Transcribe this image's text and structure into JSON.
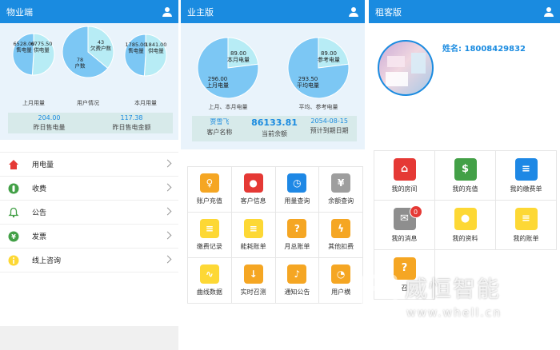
{
  "panel1": {
    "title": "物业端",
    "charts": [
      {
        "label_a_value": "6775.50",
        "label_a_name": "供电量",
        "label_b_value": "6528.00",
        "label_b_name": "售电量",
        "caption": "上月用量",
        "fractions": [
          0.51,
          0.49
        ]
      },
      {
        "label_a_value": "43",
        "label_a_name": "欠费户数",
        "label_b_value": "78",
        "label_b_name": "户数",
        "caption": "用户情况",
        "fractions": [
          0.36,
          0.64
        ]
      },
      {
        "label_a_value": "1841.00",
        "label_a_name": "供电量",
        "label_b_value": "1785.00",
        "label_b_name": "售电量",
        "caption": "本月用量",
        "fractions": [
          0.51,
          0.49
        ]
      }
    ],
    "summary": [
      {
        "value": "204.00",
        "label": "昨日售电量"
      },
      {
        "value": "117.38",
        "label": "昨日售电金额"
      }
    ],
    "menu": [
      {
        "label": "用电量",
        "icon": "home-icon",
        "color": "#e53935"
      },
      {
        "label": "收费",
        "icon": "money-icon",
        "color": "#43a047"
      },
      {
        "label": "公告",
        "icon": "bell-icon",
        "color": "#43a047"
      },
      {
        "label": "发票",
        "icon": "yen-icon",
        "color": "#43a047"
      },
      {
        "label": "线上咨询",
        "icon": "info-icon",
        "color": "#fdd835"
      }
    ]
  },
  "panel2": {
    "title": "业主版",
    "charts": [
      {
        "label_a_value": "89.00",
        "label_a_name": "本月电量",
        "label_b_value": "296.00",
        "label_b_name": "上月电量",
        "caption": "上月、本月电量",
        "fractions": [
          0.23,
          0.77
        ]
      },
      {
        "label_a_value": "89.00",
        "label_a_name": "参考电量",
        "label_b_value": "293.50",
        "label_b_name": "平均电量",
        "caption": "平均、参考电量",
        "fractions": [
          0.23,
          0.77
        ]
      }
    ],
    "info": {
      "name_value": "贾雪飞",
      "name_label": "客户名称",
      "balance_value": "86133.81",
      "balance_label": "当前余额",
      "date_value": "2054-08-15",
      "date_label": "预计到期日期"
    },
    "grid": [
      {
        "label": "账户充值",
        "color": "#f5a623",
        "glyph": "♀",
        "icon": "wallet-icon"
      },
      {
        "label": "客户信息",
        "color": "#e53935",
        "glyph": "●",
        "icon": "person-icon"
      },
      {
        "label": "用量查询",
        "color": "#1e88e5",
        "glyph": "◷",
        "icon": "clock-icon"
      },
      {
        "label": "余额查询",
        "color": "#9e9e9e",
        "glyph": "¥",
        "icon": "yen-icon"
      },
      {
        "label": "缴费记录",
        "color": "#fdd835",
        "glyph": "≡",
        "icon": "list-icon"
      },
      {
        "label": "能耗账单",
        "color": "#fdd835",
        "glyph": "≡",
        "icon": "bill-icon"
      },
      {
        "label": "月总账单",
        "color": "#f5a623",
        "glyph": "?",
        "icon": "question-icon"
      },
      {
        "label": "其他扣费",
        "color": "#f5a623",
        "glyph": "ϟ",
        "icon": "bolt-icon"
      },
      {
        "label": "曲线数据",
        "color": "#fdd835",
        "glyph": "∿",
        "icon": "curve-icon"
      },
      {
        "label": "实时召测",
        "color": "#f5a623",
        "glyph": "↓",
        "icon": "download-icon"
      },
      {
        "label": "通知公告",
        "color": "#f5a623",
        "glyph": "♪",
        "icon": "bell-icon"
      },
      {
        "label": "用户横",
        "color": "#f5a623",
        "glyph": "◔",
        "icon": "chart-icon"
      }
    ]
  },
  "panel3": {
    "title": "租客版",
    "name": "姓名: 18008429832",
    "grid": [
      {
        "label": "我的房间",
        "color": "#e53935",
        "glyph": "⌂",
        "icon": "home-icon"
      },
      {
        "label": "我的充值",
        "color": "#43a047",
        "glyph": "$",
        "icon": "dollar-icon"
      },
      {
        "label": "我的缴费单",
        "color": "#1e88e5",
        "glyph": "≡",
        "icon": "list-icon"
      },
      {
        "label": "我的消息",
        "color": "#8e8e8e",
        "glyph": "✉",
        "icon": "mail-icon",
        "badge": "0"
      },
      {
        "label": "我的资料",
        "color": "#fdd835",
        "glyph": "●",
        "icon": "person-icon"
      },
      {
        "label": "我的账单",
        "color": "#fdd835",
        "glyph": "≡",
        "icon": "bill-icon"
      },
      {
        "label": "召",
        "color": "#f5a623",
        "glyph": "?",
        "icon": "question-icon"
      }
    ]
  },
  "watermark": {
    "brand": "威恒智能",
    "url": "www.whell.cn"
  },
  "colors": {
    "accent": "#1a8be0",
    "pie_light": "#b7ecf5",
    "pie_main": "#7cc7f4",
    "hero_bg": "#e9f3fb"
  }
}
